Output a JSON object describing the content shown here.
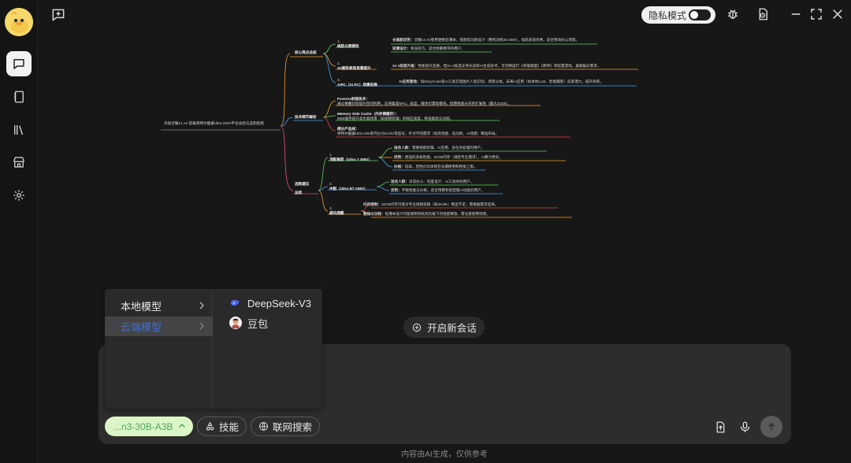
{
  "topbar": {
    "privacy_label": "隐私模式"
  },
  "mindmap": {
    "root": "华硕灵耀14 Air 搭载英特尔酷睿Ultra 200V平台总结与选购指南",
    "b1": {
      "title": "核心亮点总结",
      "c1_num": "1.",
      "c1": "续航与便携性",
      "c1a_label": "长续航优势：",
      "c1a": "灵耀14 Air使用便携轻薄本，搭配低功耗设计（整机功耗20-28W），续航表现优秀，适合移动办公场景。",
      "c1b_label": "轻薄设计：",
      "c1b": "机身轻巧，适合频繁携带的用户。",
      "c2_num": "2.",
      "c2": "3D图形表现显著提升",
      "c2a_label": "Xe 2核显升级：",
      "c2a": "性能提升显著，但Xe 2核显支持光追和AI生成技术，可流畅运行《英雄联盟》《原神》等轻量游戏，兼顾娱乐需求。",
      "c3_num": "3.",
      "c3": "AIPC（AI PC）场景拓展",
      "c3a_label": "AI应用落地：",
      "c3a": "如StoryCube等AI工具实现图片人脸识别、场景分类。未来AI应用（如本地LLM、智能摄影）前景潜力，提升效率。"
    },
    "b2": {
      "title": "技术细节解析",
      "d1": "Foveros封装技术：",
      "d1b": "通过堆叠封装提升空间利用，支持集成NPU、核显、媒体引擎等模块。但牺牲部分内存扩展性（最大32GB）。",
      "d2": "Memory Side Cache（内存侧缓存）：",
      "d2b": "8MB缓存提升高负载场景（如视频剪辑）的响应速度，降低能耗与功耗。",
      "d3": "细分产品线：",
      "d3b": "英特尔酷睿Ultra 200系列分为U/H/V等型号，针对不同需求（如高性能、低功耗、AI场景）精准布局。"
    },
    "b3": {
      "title": "选购建议",
      "title2": "总结",
      "e1_num": "1.",
      "e1": "顶配推荐（Ultra 7 258V）",
      "e1a_label": "适合人群：",
      "e1a": "需要视频剪辑、AI应用、多任务处理的用户。",
      "e1b_label": "优势：",
      "e1b": "更强的多核性能、32GB内存（满足专业需求），AI算力更优。",
      "e1c_label": "价格：",
      "e1c": "较高，但性价比体现在长期使用和性能上限。",
      "e2_num": "2.",
      "e2": "中配（Ultra 5/7 258V）",
      "e2a_label": "适合人群：",
      "e2a": "日常办公、轻度设计、AI工具体验用户。",
      "e2b_label": "优势：",
      "e2b": "平衡性能与价格，适合预算有限但需AI功能的用户。",
      "e3_num": "3.",
      "e3": "避坑提醒",
      "e3a_label": "内存限制：",
      "e3a": "32GB内存可能对专业视频剪辑（如4K/8K）略显不足，需根据需求选择。",
      "e3b_label": "散热与功耗：",
      "e3b": "轻薄本设计可能限制持续高负载下的性能释放，需注意使用场景。"
    }
  },
  "new_chat_label": "开启新会话",
  "dropdown": {
    "local_label": "本地模型",
    "cloud_label": "云端模型",
    "models": [
      "DeepSeek-V3",
      "豆包"
    ]
  },
  "input": {
    "model_chip": "...n3-30B-A3B",
    "skills_label": "技能",
    "web_search_label": "联网搜索"
  },
  "footer_note": "内容由AI生成，仅供参考"
}
